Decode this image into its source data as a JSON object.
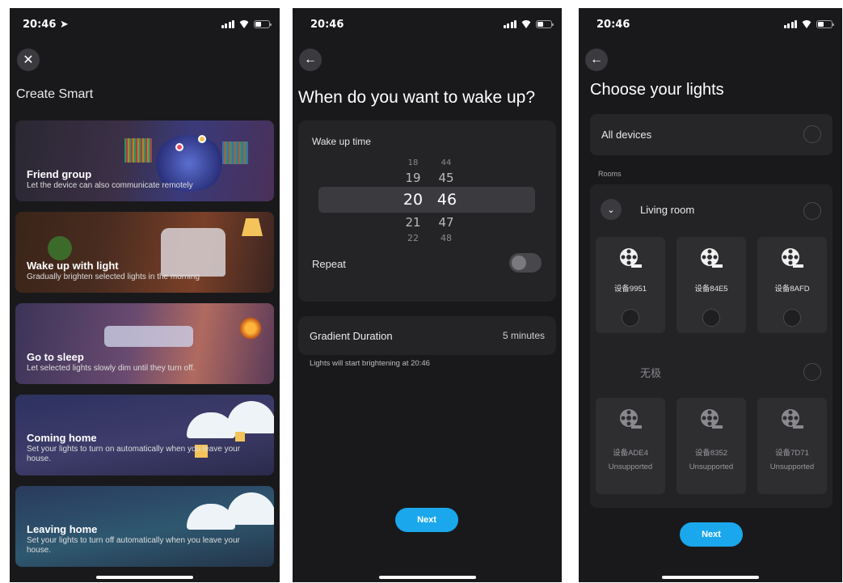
{
  "panel1": {
    "status_time": "20:46",
    "title": "Create Smart",
    "scenes": [
      {
        "name": "Friend group",
        "desc": "Let the device can also communicate remotely"
      },
      {
        "name": "Wake up with light",
        "desc": "Gradually brighten selected lights in the morning"
      },
      {
        "name": "Go to sleep",
        "desc": "Let selected lights slowly dim until they turn off."
      },
      {
        "name": "Coming home",
        "desc": "Set your lights to turn on automatically when you leave your house."
      },
      {
        "name": "Leaving home",
        "desc": "Set your lights to turn off automatically when you leave your house."
      }
    ]
  },
  "panel2": {
    "status_time": "20:46",
    "title": "When do you want to wake up?",
    "wake_label": "Wake up time",
    "hours": [
      "18",
      "19",
      "20",
      "21",
      "22"
    ],
    "minutes": [
      "44",
      "45",
      "46",
      "47",
      "48"
    ],
    "repeat_label": "Repeat",
    "gradient_label": "Gradient Duration",
    "gradient_value": "5 minutes",
    "note": "Lights will start brightening at 20:46",
    "next_label": "Next"
  },
  "panel3": {
    "status_time": "20:46",
    "title": "Choose your lights",
    "all_devices": "All devices",
    "rooms_label": "Rooms",
    "room_name": "Living room",
    "devices": [
      {
        "name": "设备9951"
      },
      {
        "name": "设备84E5"
      },
      {
        "name": "设备8AFD"
      }
    ],
    "sub_room_name": "无极",
    "unsupported_devices": [
      {
        "name": "设备ADE4",
        "status": "Unsupported"
      },
      {
        "name": "设备8352",
        "status": "Unsupported"
      },
      {
        "name": "设备7D71",
        "status": "Unsupported"
      }
    ],
    "next_label": "Next"
  },
  "colors": {
    "background": "#19191b",
    "card": "#242427",
    "accent": "#1ba7ec"
  },
  "icons": [
    "location-arrow-icon",
    "signal-icon",
    "wifi-icon",
    "battery-icon",
    "close-icon",
    "back-arrow-icon",
    "chevron-down-icon",
    "light-strip-reel-icon"
  ]
}
